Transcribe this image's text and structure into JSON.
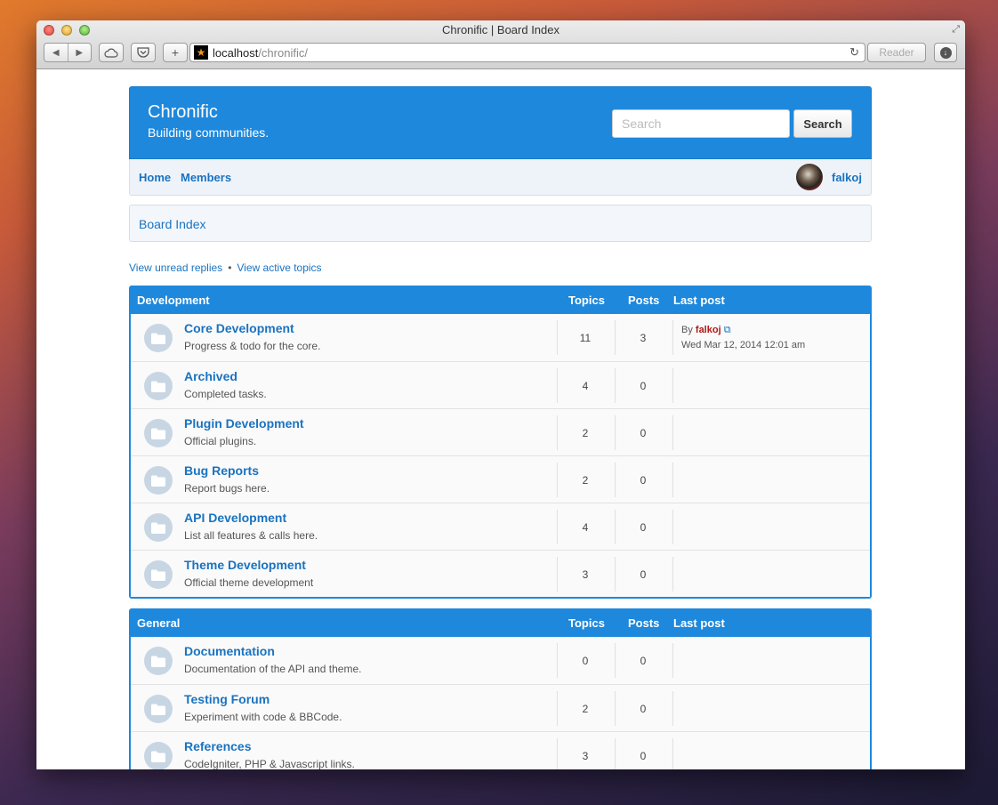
{
  "browser": {
    "window_title": "Chronific | Board Index",
    "url_host": "localhost",
    "url_path": "/chronific/",
    "reader_label": "Reader"
  },
  "site": {
    "title": "Chronific",
    "tagline": "Building communities.",
    "search_placeholder": "Search",
    "search_button": "Search"
  },
  "nav": {
    "home": "Home",
    "members": "Members",
    "username": "falkoj"
  },
  "breadcrumb": "Board Index",
  "quick_links": {
    "unread": "View unread replies",
    "separator": "•",
    "active": "View active topics"
  },
  "categories": [
    {
      "name": "Development",
      "col_topics": "Topics",
      "col_posts": "Posts",
      "col_last": "Last post",
      "forums": [
        {
          "name": "Core Development",
          "desc": "Progress & todo for the core.",
          "topics": "11",
          "posts": "3",
          "last_by": "By",
          "last_user": "falkoj",
          "last_date": "Wed Mar 12, 2014 12:01 am"
        },
        {
          "name": "Archived",
          "desc": "Completed tasks.",
          "topics": "4",
          "posts": "0"
        },
        {
          "name": "Plugin Development",
          "desc": "Official plugins.",
          "topics": "2",
          "posts": "0"
        },
        {
          "name": "Bug Reports",
          "desc": "Report bugs here.",
          "topics": "2",
          "posts": "0"
        },
        {
          "name": "API Development",
          "desc": "List all features & calls here.",
          "topics": "4",
          "posts": "0"
        },
        {
          "name": "Theme Development",
          "desc": "Official theme development",
          "topics": "3",
          "posts": "0"
        }
      ]
    },
    {
      "name": "General",
      "col_topics": "Topics",
      "col_posts": "Posts",
      "col_last": "Last post",
      "forums": [
        {
          "name": "Documentation",
          "desc": "Documentation of the API and theme.",
          "topics": "0",
          "posts": "0"
        },
        {
          "name": "Testing Forum",
          "desc": "Experiment with code & BBCode.",
          "topics": "2",
          "posts": "0"
        },
        {
          "name": "References",
          "desc": "CodeIgniter, PHP & Javascript links.",
          "topics": "3",
          "posts": "0"
        }
      ]
    }
  ]
}
